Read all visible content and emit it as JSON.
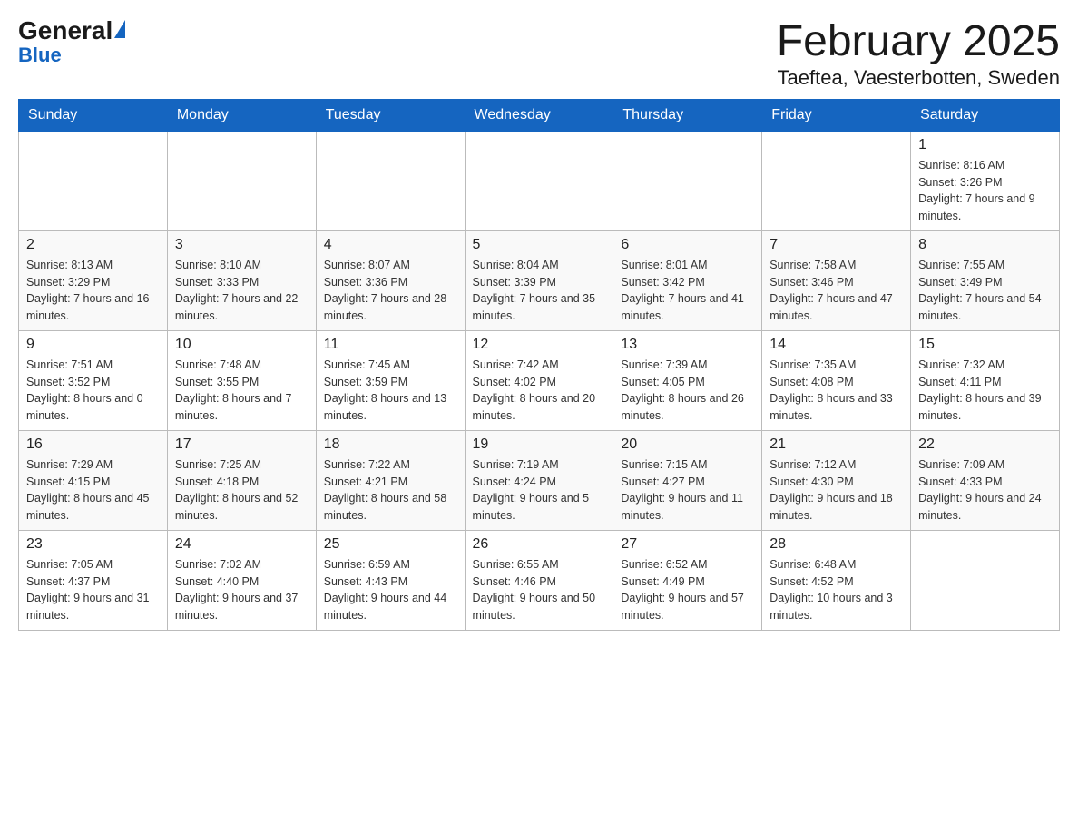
{
  "header": {
    "logo_general": "General",
    "logo_blue": "Blue",
    "title": "February 2025",
    "subtitle": "Taeftea, Vaesterbotten, Sweden"
  },
  "days_of_week": [
    "Sunday",
    "Monday",
    "Tuesday",
    "Wednesday",
    "Thursday",
    "Friday",
    "Saturday"
  ],
  "weeks": [
    {
      "days": [
        {
          "num": "",
          "info": ""
        },
        {
          "num": "",
          "info": ""
        },
        {
          "num": "",
          "info": ""
        },
        {
          "num": "",
          "info": ""
        },
        {
          "num": "",
          "info": ""
        },
        {
          "num": "",
          "info": ""
        },
        {
          "num": "1",
          "info": "Sunrise: 8:16 AM\nSunset: 3:26 PM\nDaylight: 7 hours and 9 minutes."
        }
      ]
    },
    {
      "days": [
        {
          "num": "2",
          "info": "Sunrise: 8:13 AM\nSunset: 3:29 PM\nDaylight: 7 hours and 16 minutes."
        },
        {
          "num": "3",
          "info": "Sunrise: 8:10 AM\nSunset: 3:33 PM\nDaylight: 7 hours and 22 minutes."
        },
        {
          "num": "4",
          "info": "Sunrise: 8:07 AM\nSunset: 3:36 PM\nDaylight: 7 hours and 28 minutes."
        },
        {
          "num": "5",
          "info": "Sunrise: 8:04 AM\nSunset: 3:39 PM\nDaylight: 7 hours and 35 minutes."
        },
        {
          "num": "6",
          "info": "Sunrise: 8:01 AM\nSunset: 3:42 PM\nDaylight: 7 hours and 41 minutes."
        },
        {
          "num": "7",
          "info": "Sunrise: 7:58 AM\nSunset: 3:46 PM\nDaylight: 7 hours and 47 minutes."
        },
        {
          "num": "8",
          "info": "Sunrise: 7:55 AM\nSunset: 3:49 PM\nDaylight: 7 hours and 54 minutes."
        }
      ]
    },
    {
      "days": [
        {
          "num": "9",
          "info": "Sunrise: 7:51 AM\nSunset: 3:52 PM\nDaylight: 8 hours and 0 minutes."
        },
        {
          "num": "10",
          "info": "Sunrise: 7:48 AM\nSunset: 3:55 PM\nDaylight: 8 hours and 7 minutes."
        },
        {
          "num": "11",
          "info": "Sunrise: 7:45 AM\nSunset: 3:59 PM\nDaylight: 8 hours and 13 minutes."
        },
        {
          "num": "12",
          "info": "Sunrise: 7:42 AM\nSunset: 4:02 PM\nDaylight: 8 hours and 20 minutes."
        },
        {
          "num": "13",
          "info": "Sunrise: 7:39 AM\nSunset: 4:05 PM\nDaylight: 8 hours and 26 minutes."
        },
        {
          "num": "14",
          "info": "Sunrise: 7:35 AM\nSunset: 4:08 PM\nDaylight: 8 hours and 33 minutes."
        },
        {
          "num": "15",
          "info": "Sunrise: 7:32 AM\nSunset: 4:11 PM\nDaylight: 8 hours and 39 minutes."
        }
      ]
    },
    {
      "days": [
        {
          "num": "16",
          "info": "Sunrise: 7:29 AM\nSunset: 4:15 PM\nDaylight: 8 hours and 45 minutes."
        },
        {
          "num": "17",
          "info": "Sunrise: 7:25 AM\nSunset: 4:18 PM\nDaylight: 8 hours and 52 minutes."
        },
        {
          "num": "18",
          "info": "Sunrise: 7:22 AM\nSunset: 4:21 PM\nDaylight: 8 hours and 58 minutes."
        },
        {
          "num": "19",
          "info": "Sunrise: 7:19 AM\nSunset: 4:24 PM\nDaylight: 9 hours and 5 minutes."
        },
        {
          "num": "20",
          "info": "Sunrise: 7:15 AM\nSunset: 4:27 PM\nDaylight: 9 hours and 11 minutes."
        },
        {
          "num": "21",
          "info": "Sunrise: 7:12 AM\nSunset: 4:30 PM\nDaylight: 9 hours and 18 minutes."
        },
        {
          "num": "22",
          "info": "Sunrise: 7:09 AM\nSunset: 4:33 PM\nDaylight: 9 hours and 24 minutes."
        }
      ]
    },
    {
      "days": [
        {
          "num": "23",
          "info": "Sunrise: 7:05 AM\nSunset: 4:37 PM\nDaylight: 9 hours and 31 minutes."
        },
        {
          "num": "24",
          "info": "Sunrise: 7:02 AM\nSunset: 4:40 PM\nDaylight: 9 hours and 37 minutes."
        },
        {
          "num": "25",
          "info": "Sunrise: 6:59 AM\nSunset: 4:43 PM\nDaylight: 9 hours and 44 minutes."
        },
        {
          "num": "26",
          "info": "Sunrise: 6:55 AM\nSunset: 4:46 PM\nDaylight: 9 hours and 50 minutes."
        },
        {
          "num": "27",
          "info": "Sunrise: 6:52 AM\nSunset: 4:49 PM\nDaylight: 9 hours and 57 minutes."
        },
        {
          "num": "28",
          "info": "Sunrise: 6:48 AM\nSunset: 4:52 PM\nDaylight: 10 hours and 3 minutes."
        },
        {
          "num": "",
          "info": ""
        }
      ]
    }
  ]
}
